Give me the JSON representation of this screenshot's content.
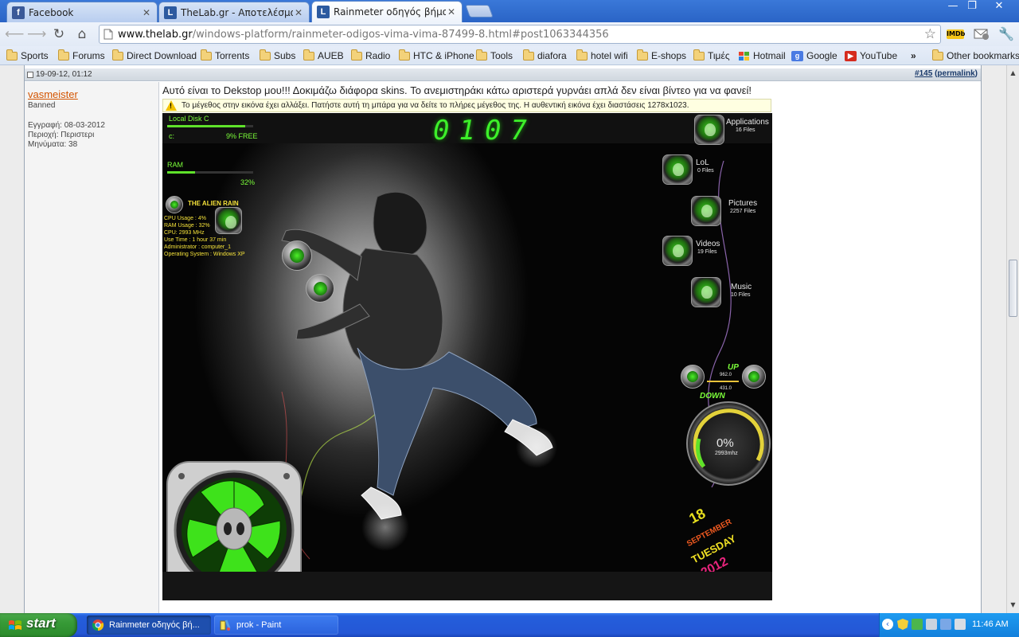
{
  "browser": {
    "tabs": [
      {
        "label": "Facebook",
        "favicon": "f",
        "favcolor": "#3b5998"
      },
      {
        "label": "TheLab.gr - Αποτελέσματα Αι",
        "favicon": "L",
        "favcolor": "#2c5aa0"
      },
      {
        "label": "Rainmeter οδηγός βήμα βήμα",
        "favicon": "L",
        "favcolor": "#2c5aa0"
      }
    ],
    "close_glyph": "✕",
    "window_controls": {
      "minimize": "—",
      "maximize": "❐",
      "close": "✕"
    },
    "url": {
      "host": "www.thelab.gr",
      "path": "/windows-platform/rainmeter-odigos-vima-vima-87499-8.html#post1063344356"
    },
    "toolbar_icons": {
      "imdb": "IMDb"
    },
    "bookmarks": [
      {
        "label": "Sports",
        "type": "folder"
      },
      {
        "label": "Forums",
        "type": "folder"
      },
      {
        "label": "Direct Download",
        "type": "folder"
      },
      {
        "label": "Torrents",
        "type": "folder"
      },
      {
        "label": "Subs",
        "type": "folder"
      },
      {
        "label": "AUEB",
        "type": "folder"
      },
      {
        "label": "Radio",
        "type": "folder"
      },
      {
        "label": "HTC & iPhone",
        "type": "folder"
      },
      {
        "label": "Tools",
        "type": "folder"
      },
      {
        "label": "diafora",
        "type": "folder"
      },
      {
        "label": "hotel wifi",
        "type": "folder"
      },
      {
        "label": "E-shops",
        "type": "folder"
      },
      {
        "label": "Τιμές",
        "type": "folder"
      },
      {
        "label": "Hotmail",
        "type": "site",
        "icon": "windows-logo-icon"
      },
      {
        "label": "Google",
        "type": "site",
        "icon": "google-icon"
      },
      {
        "label": "YouTube",
        "type": "site",
        "icon": "youtube-icon"
      }
    ],
    "bookmarks_overflow": "»",
    "other_bookmarks": "Other bookmarks"
  },
  "post": {
    "date": "19-09-12, 01:12",
    "number": "#145",
    "number_prefix": "#",
    "number_value": "145",
    "permalink": "permalink",
    "username": "vasmeister",
    "user_title": "Banned",
    "stats": [
      "Εγγραφή: 08-03-2012",
      "Περιοχή: Περιστερι",
      "Μηνύματα: 38"
    ],
    "body": "Αυτό είναι το Dekstop μου!!! Δοκιμάζω διάφορα skins. Το ανεμιστηράκι κάτω αριστερά γυρνάει απλά δεν είναι βίντεο για να φανεί!",
    "resize_notice": "Το μέγεθος στην εικόνα έχει αλλάξει. Πατήστε αυτή τη μπάρα για να δείτε το πλήρες μέγεθος της. Η αυθεντική εικόνα έχει διαστάσεις 1278x1023."
  },
  "desktop": {
    "disk": {
      "label": "Local Disk C",
      "drive": "c:",
      "free": "9% FREE",
      "used_fraction": 0.91
    },
    "clock": "0107",
    "ram": {
      "label": "RAM",
      "percent": "32%",
      "fraction": 0.32
    },
    "sysinfo": {
      "title": "THE ALIEN RAIN",
      "rows": [
        {
          "k": "CPU Usage :",
          "v": "4%"
        },
        {
          "k": "RAM Usage :",
          "v": "32%"
        },
        {
          "k": "CPU:",
          "v": "2993 MHz"
        },
        {
          "k": "Use Time :",
          "v": "1 hour 37 min"
        },
        {
          "k": "Administrator :",
          "v": "computer_1"
        },
        {
          "k": "Operating System :",
          "v": "Windows XP"
        }
      ]
    },
    "launchers": [
      {
        "name": "Applications",
        "files": "16 Files"
      },
      {
        "name": "LoL",
        "files": "0 Files"
      },
      {
        "name": "Pictures",
        "files": "2257 Files"
      },
      {
        "name": "Videos",
        "files": "19 Files"
      },
      {
        "name": "Music",
        "files": "10 Files"
      }
    ],
    "network": {
      "up": "UP",
      "down": "DOWN",
      "up_value": "962.0",
      "down_value": "431.0"
    },
    "cpu_gauge": {
      "percent": "0%",
      "mhz": "2993mhz"
    },
    "calendar": {
      "day": "18",
      "month": "SEPTEMBER",
      "weekday": "TUESDAY",
      "year": "2012"
    }
  },
  "taskbar": {
    "start": "start",
    "items": [
      {
        "label": "Rainmeter οδηγός βή...",
        "active": true,
        "icon": "chrome-icon"
      },
      {
        "label": "prok - Paint",
        "active": false,
        "icon": "paint-icon"
      }
    ],
    "clock": "11:46 AM"
  },
  "colors": {
    "accent_green": "#5fe22a",
    "xp_blue": "#245edb",
    "username": "#d35400"
  }
}
